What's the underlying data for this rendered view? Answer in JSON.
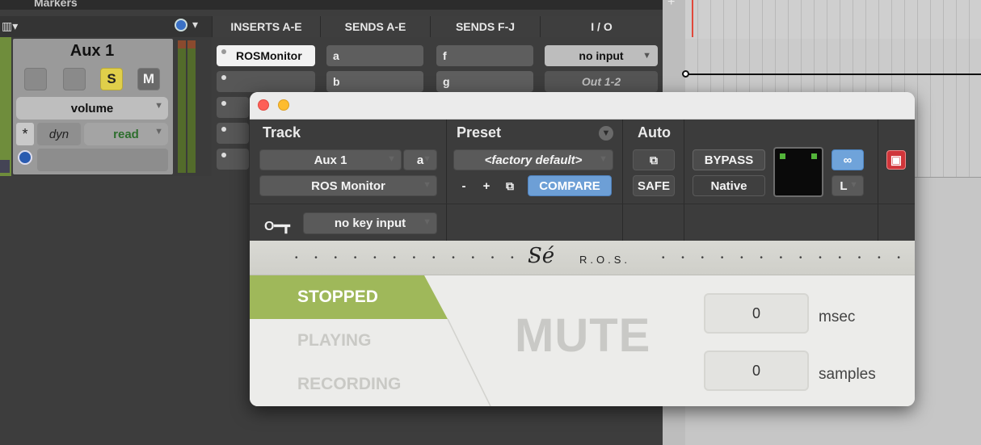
{
  "daw": {
    "markers_label": "Markers",
    "track": {
      "name": "Aux 1",
      "solo": "S",
      "mute": "M",
      "view": "volume",
      "automation_star": "*",
      "dyn": "dyn",
      "automation_mode": "read"
    },
    "columns": {
      "inserts": "INSERTS A-E",
      "sends_ae": "SENDS A-E",
      "sends_fj": "SENDS F-J",
      "io": "I / O"
    },
    "insert_a": "ROSMonitor",
    "sends": [
      "a",
      "b"
    ],
    "sends_fj": [
      "f",
      "g"
    ],
    "io": {
      "input": "no input",
      "output": "Out 1-2"
    }
  },
  "plugin": {
    "sections": {
      "track": "Track",
      "preset": "Preset",
      "auto": "Auto"
    },
    "track_name": "Aux 1",
    "track_chan": "a",
    "plugin_name": "ROS Monitor",
    "preset_name": "<factory default>",
    "preset_minus": "-",
    "preset_plus": "+",
    "compare": "COMPARE",
    "safe": "SAFE",
    "bypass": "BYPASS",
    "native": "Native",
    "link_side": "L",
    "key_input": "no key input",
    "brand_logo": "Sé",
    "brand_name": "R.O.S.",
    "brand_dots": "• • • • • • • • • • • • •",
    "states": {
      "stopped": "STOPPED",
      "playing": "PLAYING",
      "recording": "RECORDING"
    },
    "active_state": "stopped",
    "mute_label": "MUTE",
    "msec_value": "0",
    "msec_unit": "msec",
    "samples_value": "0",
    "samples_unit": "samples",
    "accent_color": "#9fb85a",
    "compare_color": "#6d9fd6"
  }
}
